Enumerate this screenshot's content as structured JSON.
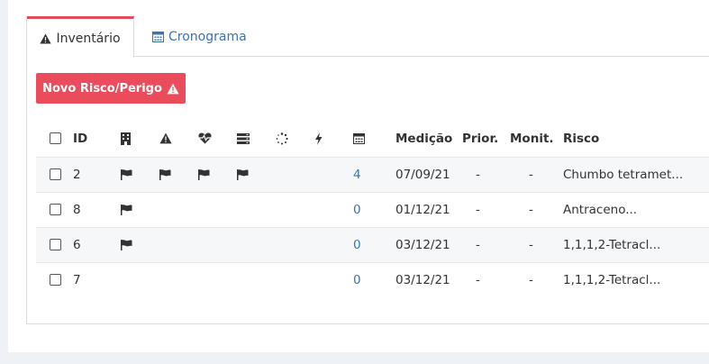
{
  "tabs": [
    {
      "label": "Inventário",
      "icon": "warning-icon",
      "active": true
    },
    {
      "label": "Cronograma",
      "icon": "calendar-icon",
      "active": false
    }
  ],
  "new_button": {
    "label": "Novo Risco/Perigo",
    "icon": "warning-icon"
  },
  "table": {
    "headers": {
      "id": "ID",
      "col_icons": [
        "building-icon",
        "warning-icon",
        "heartbeat-icon",
        "server-icon",
        "spinner-icon",
        "bolt-icon",
        "calendar-icon"
      ],
      "medicao": "Medição",
      "prior": "Prior.",
      "monit": "Monit.",
      "risco": "Risco"
    },
    "rows": [
      {
        "id": "2",
        "flags": [
          true,
          true,
          true,
          true,
          false,
          false
        ],
        "count": "4",
        "medicao": "07/09/21",
        "prior": "-",
        "monit": "-",
        "risco": "Chumbo tetramet..."
      },
      {
        "id": "8",
        "flags": [
          true,
          false,
          false,
          false,
          false,
          false
        ],
        "count": "0",
        "medicao": "01/12/21",
        "prior": "-",
        "monit": "-",
        "risco": "Antraceno..."
      },
      {
        "id": "6",
        "flags": [
          true,
          false,
          false,
          false,
          false,
          false
        ],
        "count": "0",
        "medicao": "03/12/21",
        "prior": "-",
        "monit": "-",
        "risco": "1,1,1,2-Tetracl..."
      },
      {
        "id": "7",
        "flags": [
          false,
          false,
          false,
          false,
          false,
          false
        ],
        "count": "0",
        "medicao": "03/12/21",
        "prior": "-",
        "monit": "-",
        "risco": "1,1,1,2-Tetracl..."
      }
    ]
  },
  "colors": {
    "accent": "#ea4c5c",
    "link": "#3b73b9"
  }
}
